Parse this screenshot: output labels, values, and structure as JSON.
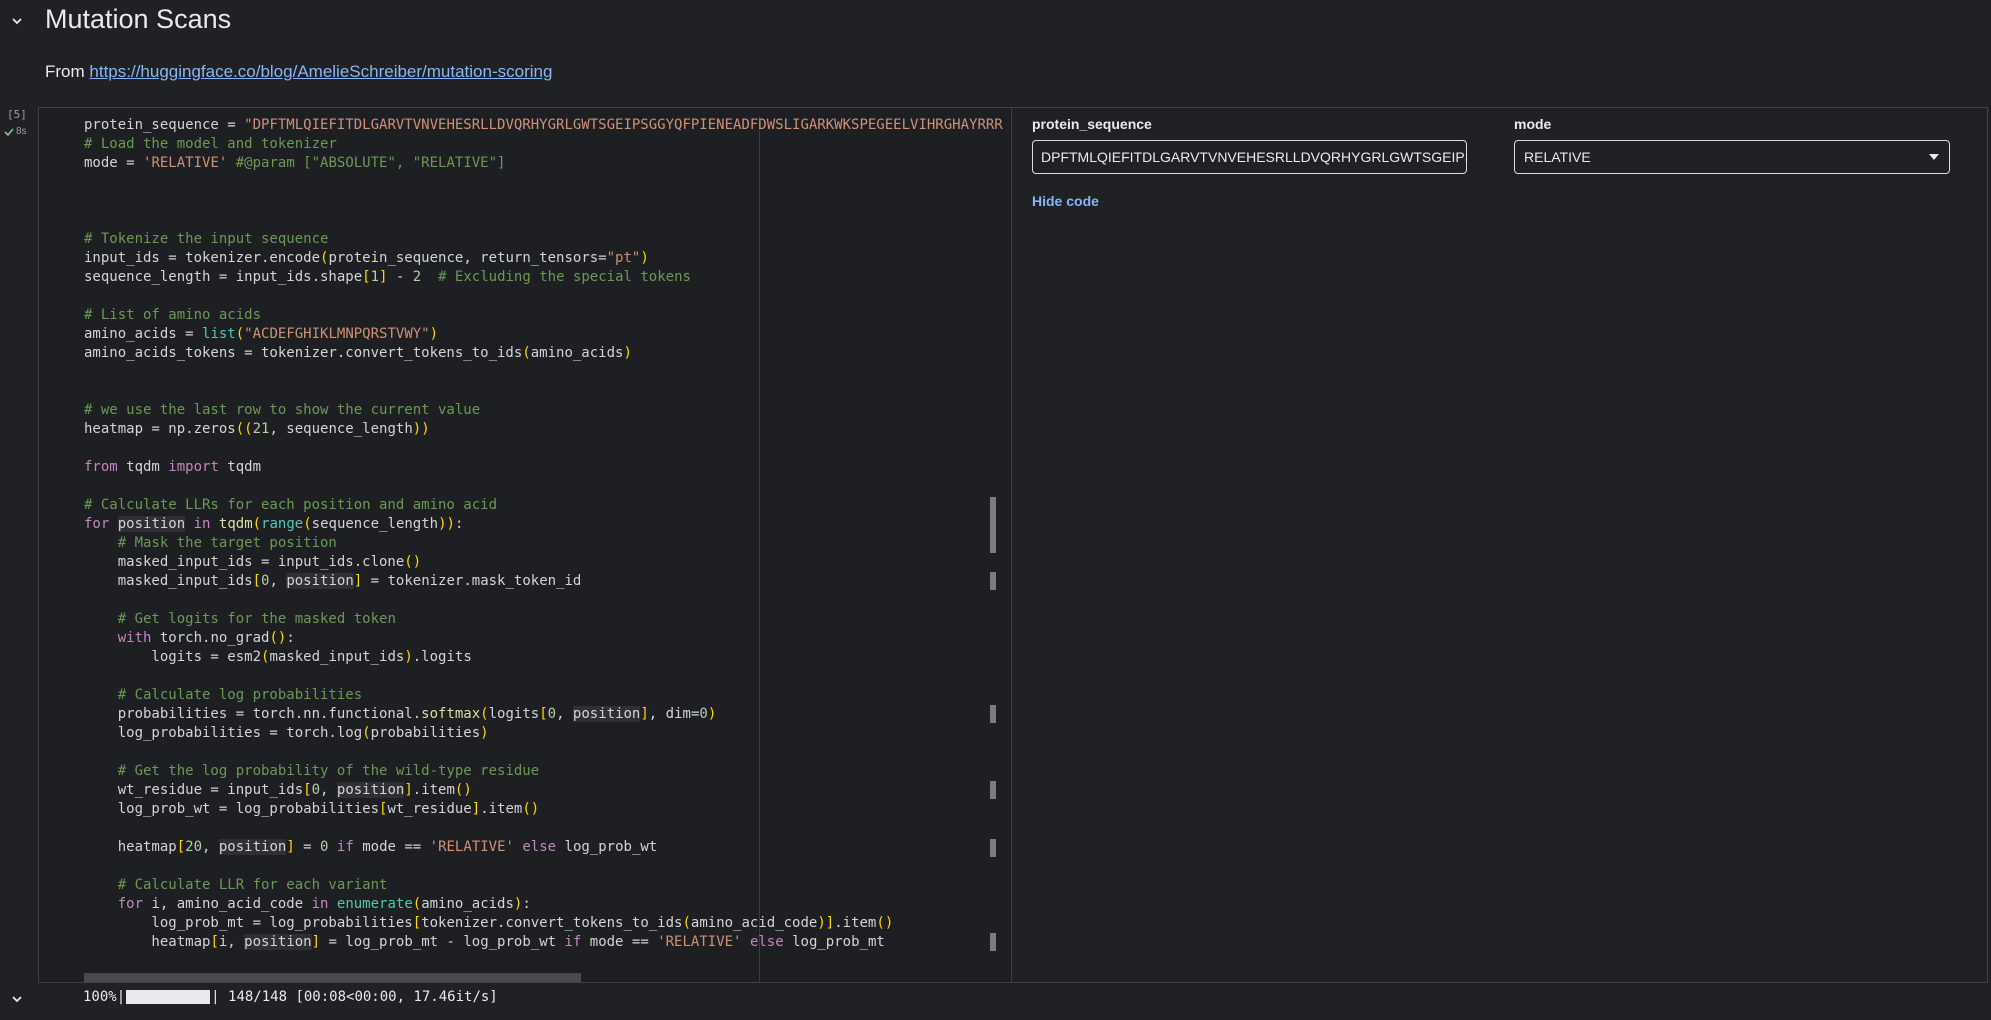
{
  "section": {
    "title": "Mutation Scans"
  },
  "description": {
    "prefix": "From ",
    "link": "https://huggingface.co/blog/AmelieSchreiber/mutation-scoring"
  },
  "cell": {
    "exec_count": "[5]",
    "exec_time": "8s"
  },
  "form": {
    "protein_sequence_label": "protein_sequence",
    "protein_sequence_value": "DPFTMLQIEFITDLGARVTVNVEHESRLLDVQRHYGRLGWTSGEIPSG",
    "mode_label": "mode",
    "mode_value": "RELATIVE",
    "hide_code": "Hide code"
  },
  "output": {
    "percent": "100%|",
    "progress_fraction": 1.0,
    "stats": "| 148/148 [00:08<00:00, 17.46it/s]"
  },
  "icons": [
    "chevron-down-icon",
    "check-icon",
    "dropdown-arrow-icon"
  ],
  "code": {
    "lines": [
      "protein_sequence = \"DPFTMLQIEFITDLGARVTVNVEHESRLLDVQRHYGRLGWTSGEIPSGGYQFPIENEADFDWSLIGARKWKSPEGEELVIHRGHAYRRR",
      "# Load the model and tokenizer",
      "mode = 'RELATIVE' #@param [\"ABSOLUTE\", \"RELATIVE\"]",
      "",
      "",
      "",
      "# Tokenize the input sequence",
      "input_ids = tokenizer.encode(protein_sequence, return_tensors=\"pt\")",
      "sequence_length = input_ids.shape[1] - 2  # Excluding the special tokens",
      "",
      "# List of amino acids",
      "amino_acids = list(\"ACDEFGHIKLMNPQRSTVWY\")",
      "amino_acids_tokens = tokenizer.convert_tokens_to_ids(amino_acids)",
      "",
      "",
      "# we use the last row to show the current value",
      "heatmap = np.zeros((21, sequence_length))",
      "",
      "from tqdm import tqdm",
      "",
      "# Calculate LLRs for each position and amino acid",
      "for position in tqdm(range(sequence_length)):",
      "    # Mask the target position",
      "    masked_input_ids = input_ids.clone()",
      "    masked_input_ids[0, position] = tokenizer.mask_token_id",
      "",
      "    # Get logits for the masked token",
      "    with torch.no_grad():",
      "        logits = esm2(masked_input_ids).logits",
      "",
      "    # Calculate log probabilities",
      "    probabilities = torch.nn.functional.softmax(logits[0, position], dim=0)",
      "    log_probabilities = torch.log(probabilities)",
      "",
      "    # Get the log probability of the wild-type residue",
      "    wt_residue = input_ids[0, position].item()",
      "    log_prob_wt = log_probabilities[wt_residue].item()",
      "",
      "    heatmap[20, position] = 0 if mode == 'RELATIVE' else log_prob_wt",
      "",
      "    # Calculate LLR for each variant",
      "    for i, amino_acid_code in enumerate(amino_acids):",
      "        log_prob_mt = log_probabilities[tokenizer.convert_tokens_to_ids(amino_acid_code)].item()",
      "        heatmap[i, position] = log_prob_mt - log_prob_wt if mode == 'RELATIVE' else log_prob_mt"
    ]
  }
}
